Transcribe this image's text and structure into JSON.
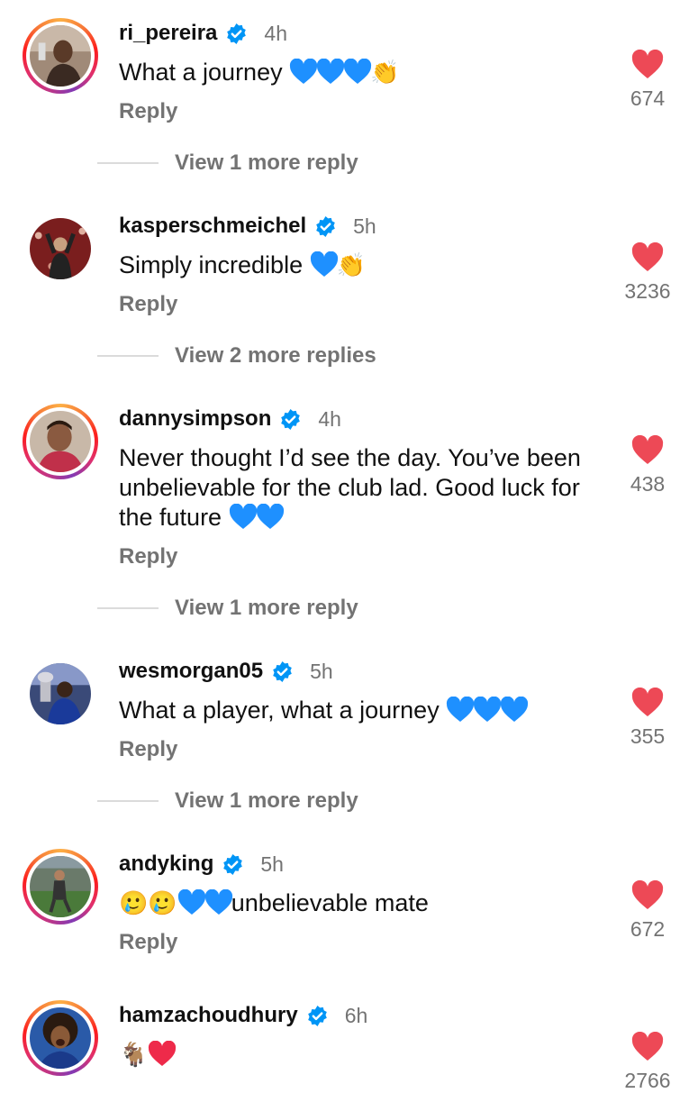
{
  "colors": {
    "heart": "#ed4956",
    "verified": "#0095f6",
    "blue_heart": "#1e90ff",
    "muted": "#737373"
  },
  "comments": [
    {
      "username": "ri_pereira",
      "time": "4h",
      "text": "What a journey",
      "emojis": "💙💙💙👏",
      "reply": "Reply",
      "likes": "674",
      "more": "View 1 more reply",
      "story": true
    },
    {
      "username": "kasperschmeichel",
      "time": "5h",
      "text": "Simply incredible",
      "emojis": "💙👏",
      "reply": "Reply",
      "likes": "3236",
      "more": "View 2 more replies",
      "story": false
    },
    {
      "username": "dannysimpson",
      "time": "4h",
      "text": "Never thought I’d see the day. You’ve been unbelievable for the club lad. Good luck for the future",
      "emojis": "💙💙",
      "reply": "Reply",
      "likes": "438",
      "more": "View 1 more reply",
      "story": true
    },
    {
      "username": "wesmorgan05",
      "time": "5h",
      "text": "What a player, what a journey",
      "emojis": "💙💙💙",
      "reply": "Reply",
      "likes": "355",
      "more": "View 1 more reply",
      "story": false
    },
    {
      "username": "andyking",
      "time": "5h",
      "text": "unbelievable mate",
      "emojis": "🥲🥲💙💙",
      "reply": "Reply",
      "likes": "672",
      "more": "",
      "story": true
    },
    {
      "username": "hamzachoudhury",
      "time": "6h",
      "text": "",
      "emojis": "🐐❤️",
      "reply": "",
      "likes": "2766",
      "more": "",
      "story": true
    }
  ]
}
